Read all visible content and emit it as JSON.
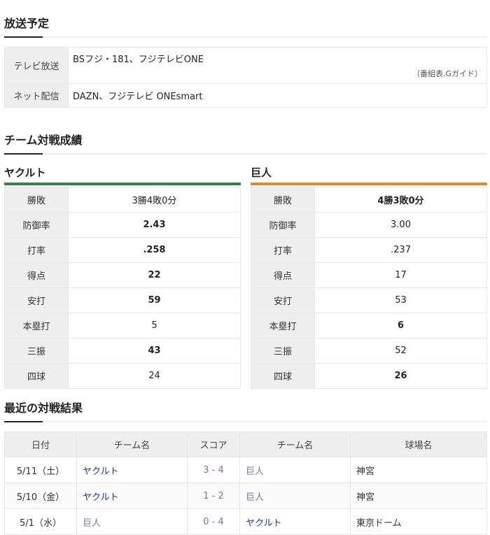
{
  "broadcast": {
    "title": "放送予定",
    "rows": [
      {
        "label": "テレビ放送",
        "value": "BSフジ・181、フジテレビONE",
        "note": "（番組表.Gガイド）"
      },
      {
        "label": "ネット配信",
        "value": "DAZN、フジテレビ ONEsmart"
      }
    ]
  },
  "record": {
    "title": "チーム対戦成績",
    "colors": {
      "yakult": "#3a7d4f",
      "giants": "#e08a2c"
    },
    "left": {
      "team": "ヤクルト",
      "rows": [
        {
          "label": "勝敗",
          "value": "3勝4敗0分",
          "bold": false
        },
        {
          "label": "防御率",
          "value": "2.43",
          "bold": true
        },
        {
          "label": "打率",
          "value": ".258",
          "bold": true
        },
        {
          "label": "得点",
          "value": "22",
          "bold": true
        },
        {
          "label": "安打",
          "value": "59",
          "bold": true
        },
        {
          "label": "本塁打",
          "value": "5",
          "bold": false
        },
        {
          "label": "三振",
          "value": "43",
          "bold": true
        },
        {
          "label": "四球",
          "value": "24",
          "bold": false
        }
      ]
    },
    "right": {
      "team": "巨人",
      "rows": [
        {
          "label": "勝敗",
          "value": "4勝3敗0分",
          "bold": true
        },
        {
          "label": "防御率",
          "value": "3.00",
          "bold": false
        },
        {
          "label": "打率",
          "value": ".237",
          "bold": false
        },
        {
          "label": "得点",
          "value": "17",
          "bold": false
        },
        {
          "label": "安打",
          "value": "53",
          "bold": false
        },
        {
          "label": "本塁打",
          "value": "6",
          "bold": true
        },
        {
          "label": "三振",
          "value": "52",
          "bold": false
        },
        {
          "label": "四球",
          "value": "26",
          "bold": true
        }
      ]
    }
  },
  "recent": {
    "title": "最近の対戦結果",
    "headers": [
      "日付",
      "チーム名",
      "スコア",
      "チーム名",
      "球場名"
    ],
    "rows": [
      {
        "date": "5/11（土）",
        "home": "ヤクルト",
        "score": "3 - 4",
        "away": "巨人",
        "stadium": "神宮"
      },
      {
        "date": "5/10（金）",
        "home": "ヤクルト",
        "score": "1 - 2",
        "away": "巨人",
        "stadium": "神宮"
      },
      {
        "date": "5/1（水）",
        "home": "巨人",
        "score": "0 - 4",
        "away": "ヤクルト",
        "stadium": "東京ドーム"
      }
    ]
  }
}
